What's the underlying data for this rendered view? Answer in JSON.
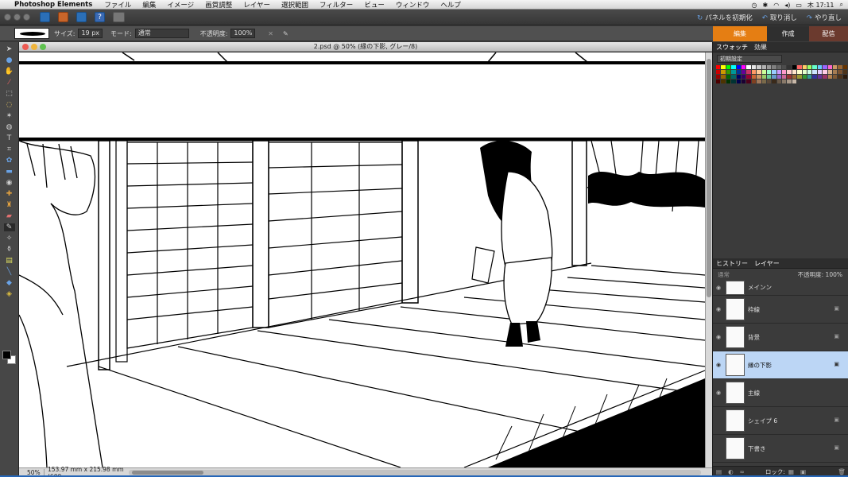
{
  "menubar": {
    "app_name": "Photoshop Elements",
    "items": [
      "ファイル",
      "編集",
      "イメージ",
      "画質調整",
      "レイヤー",
      "選択範囲",
      "フィルター",
      "ビュー",
      "ウィンドウ",
      "ヘルプ"
    ],
    "clock": "木 17:11"
  },
  "appbar": {
    "reset_panels": "パネルを初期化",
    "undo": "取り消し",
    "redo": "やり直し"
  },
  "options": {
    "size_label": "サイズ:",
    "size_value": "19 px",
    "mode_label": "モード:",
    "mode_value": "通常",
    "opacity_label": "不透明度:",
    "opacity_value": "100%"
  },
  "modes": {
    "edit": "編集",
    "create": "作成",
    "share": "配信"
  },
  "document": {
    "title": "2.psd @ 50% (縁の下影, グレー/8)",
    "zoom": "50%",
    "info": "153.97 mm x 215.98 mm (600..."
  },
  "swatches_panel": {
    "tabs": [
      "スウォッチ",
      "効果"
    ],
    "preset": "初期設定",
    "colors": [
      "#ff0000",
      "#ffff00",
      "#00ff00",
      "#00ffff",
      "#0000ff",
      "#ff00ff",
      "#ffffff",
      "#e6e6e6",
      "#cccccc",
      "#b3b3b3",
      "#999999",
      "#808080",
      "#666666",
      "#4d4d4d",
      "#333333",
      "#000000",
      "#ff6666",
      "#ffcc66",
      "#99ff66",
      "#66ffcc",
      "#66ccff",
      "#9966ff",
      "#ff66cc",
      "#cc9966",
      "#996633",
      "#663300",
      "#cc0000",
      "#cc9900",
      "#339900",
      "#009999",
      "#003399",
      "#660099",
      "#cc3366",
      "#ff9966",
      "#ffcc99",
      "#ccff99",
      "#99ffcc",
      "#99ccff",
      "#cc99ff",
      "#ff99cc",
      "#ffcccc",
      "#ffe5cc",
      "#ffffcc",
      "#e5ffcc",
      "#ccffe5",
      "#cce5ff",
      "#e5ccff",
      "#ffcce5",
      "#d9b38c",
      "#a67c52",
      "#7a5230",
      "#4d3319",
      "#990000",
      "#996600",
      "#006600",
      "#006666",
      "#000066",
      "#330066",
      "#990033",
      "#cc6633",
      "#cc9966",
      "#99cc66",
      "#66cc99",
      "#6699cc",
      "#9966cc",
      "#cc6699",
      "#993333",
      "#996633",
      "#999933",
      "#339933",
      "#339999",
      "#333399",
      "#663399",
      "#993366",
      "#b3804d",
      "#805933",
      "#4d331a",
      "#2b1a0d",
      "#4d0000",
      "#4d3300",
      "#003300",
      "#003333",
      "#00004d",
      "#1a0033",
      "#4d001a",
      "#804020",
      "#a0785a",
      "#7a6a4a",
      "#5a4a3a",
      "#3a2a1a",
      "#6a5a4a",
      "#8a7a6a",
      "#aa9a8a",
      "#c8b8a8"
    ]
  },
  "layers_panel": {
    "tabs": [
      "ヒストリー",
      "レイヤー"
    ],
    "blend_mode": "通常",
    "opacity_label": "不透明度:",
    "opacity_value": "100%",
    "layers": [
      {
        "name": "メインン"
      },
      {
        "name": "枠線"
      },
      {
        "name": "背景"
      },
      {
        "name": "縁の下影"
      },
      {
        "name": "主線"
      },
      {
        "name": "シェイプ 6"
      },
      {
        "name": "下書き"
      }
    ],
    "lock_label": "ロック:"
  }
}
